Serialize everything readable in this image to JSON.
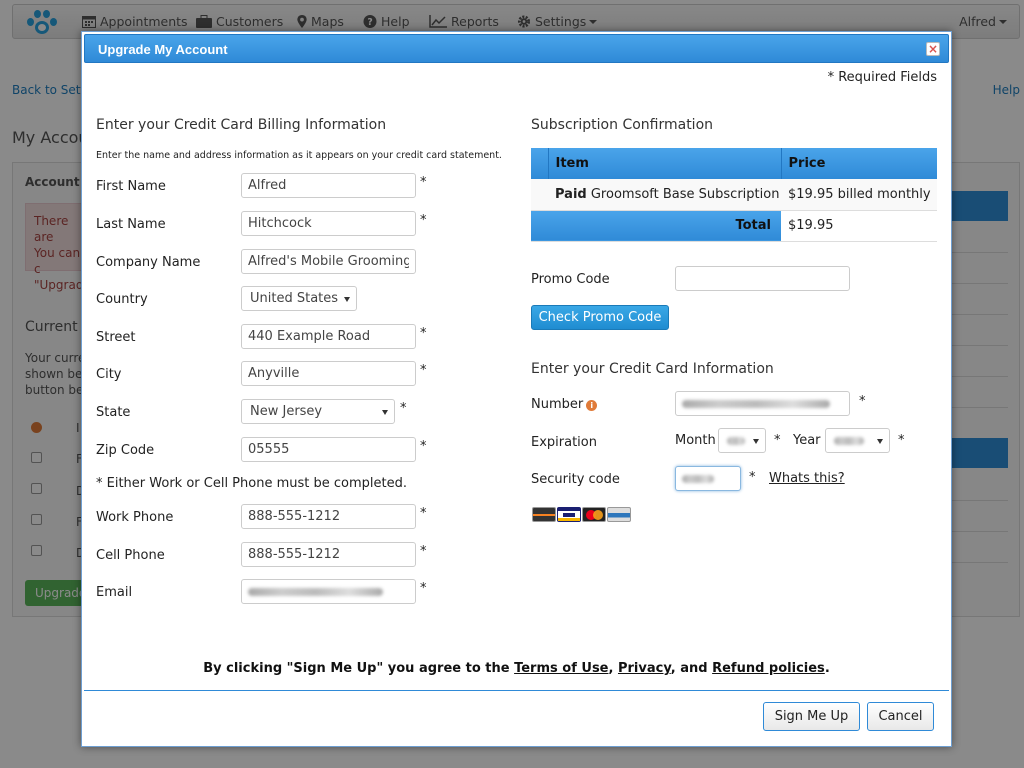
{
  "nav": {
    "items": [
      {
        "label": "Appointments",
        "icon": "calendar-icon"
      },
      {
        "label": "Customers",
        "icon": "briefcase-icon"
      },
      {
        "label": "Maps",
        "icon": "map-marker-icon"
      },
      {
        "label": "Help",
        "icon": "question-circle-icon"
      },
      {
        "label": "Reports",
        "icon": "line-chart-icon"
      },
      {
        "label": "Settings",
        "icon": "gear-icon"
      }
    ],
    "user": "Alfred"
  },
  "background": {
    "back_link": "Back to Settin",
    "help_link": "Help",
    "title": "My Accoun",
    "panel_head": "Account S",
    "alert_lines": [
      "There are",
      "You can c",
      "\"Upgrade"
    ],
    "current_sub": "Current S",
    "text_lines": [
      "Your curren",
      "shown belo",
      "button belo"
    ],
    "upgrade_button": "Upgrade",
    "list_initials": [
      "F",
      "D",
      "F",
      "D"
    ]
  },
  "modal": {
    "title": "Upgrade My Account",
    "close_label": "×",
    "required_note": "* Required Fields",
    "billing": {
      "heading": "Enter your Credit Card Billing Information",
      "hint": "Enter the name and address information as it appears on your credit card statement.",
      "first_name_label": "First Name",
      "first_name": "Alfred",
      "last_name_label": "Last Name",
      "last_name": "Hitchcock",
      "company_label": "Company Name",
      "company": "Alfred's Mobile Grooming",
      "country_label": "Country",
      "country": "United States",
      "street_label": "Street",
      "street": "440 Example Road",
      "city_label": "City",
      "city": "Anyville",
      "state_label": "State",
      "state": "New Jersey",
      "zip_label": "Zip Code",
      "zip": "05555",
      "either_note": "* Either Work or Cell Phone must be completed.",
      "work_phone_label": "Work Phone",
      "work_phone": "888-555-1212",
      "cell_phone_label": "Cell Phone",
      "cell_phone": "888-555-1212",
      "email_label": "Email",
      "required_marker": "*"
    },
    "subscription": {
      "heading": "Subscription Confirmation",
      "col_item": "Item",
      "col_price": "Price",
      "row_status": "Paid",
      "row_name": "Groomsoft Base Subscription",
      "row_price": "$19.95 billed monthly",
      "total_label": "Total",
      "total_value": "$19.95",
      "promo_label": "Promo Code",
      "promo_value": "",
      "promo_button": "Check Promo Code"
    },
    "card": {
      "heading": "Enter your Credit Card Information",
      "number_label": "Number",
      "expiration_label": "Expiration",
      "month_label": "Month",
      "year_label": "Year",
      "security_label": "Security code",
      "whats_this": "Whats this?",
      "card_brands": [
        "Discover",
        "VISA",
        "MasterCard",
        "American Express"
      ]
    },
    "agree": {
      "prefix": "By clicking \"Sign Me Up\" you agree to the ",
      "terms": "Terms of Use",
      "comma": ", ",
      "privacy": "Privacy",
      "and": ", and ",
      "refund": "Refund policies",
      "suffix": "."
    },
    "buttons": {
      "sign_up": "Sign Me Up",
      "cancel": "Cancel"
    }
  }
}
